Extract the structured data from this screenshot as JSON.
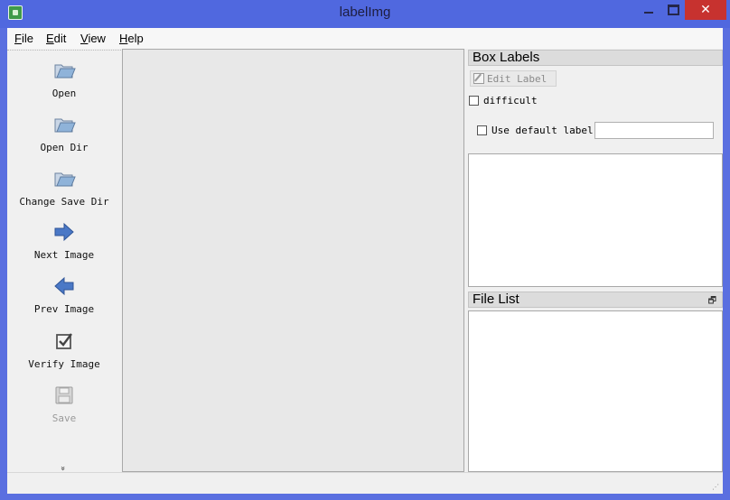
{
  "window": {
    "title": "labelImg",
    "close_glyph": "✕"
  },
  "menu": {
    "items": [
      {
        "label": "File",
        "accel": "F",
        "rest": "ile"
      },
      {
        "label": "Edit",
        "accel": "E",
        "rest": "dit"
      },
      {
        "label": "View",
        "accel": "V",
        "rest": "iew"
      },
      {
        "label": "Help",
        "accel": "H",
        "rest": "elp"
      }
    ]
  },
  "toolbar": {
    "items": [
      {
        "label": "Open",
        "icon": "folder-icon",
        "enabled": true
      },
      {
        "label": "Open Dir",
        "icon": "folder-icon",
        "enabled": true
      },
      {
        "label": "Change Save Dir",
        "icon": "folder-icon",
        "enabled": true
      },
      {
        "label": "Next Image",
        "icon": "arrow-right-icon",
        "enabled": true
      },
      {
        "label": "Prev Image",
        "icon": "arrow-left-icon",
        "enabled": true
      },
      {
        "label": "Verify Image",
        "icon": "checkbox-icon",
        "enabled": true
      },
      {
        "label": "Save",
        "icon": "save-icon",
        "enabled": false
      }
    ],
    "more_glyph": "»"
  },
  "box_labels": {
    "title": "Box Labels",
    "edit_label": "Edit Label",
    "difficult": "difficult",
    "use_default_label": "Use default label",
    "default_label_value": ""
  },
  "file_list": {
    "title": "File List",
    "float_glyph": "🗗"
  },
  "colors": {
    "titlebar": "#5068df",
    "close_button": "#c7322f",
    "arrow_blue": "#4a78c6",
    "folder_blue": "#8fb3d9"
  }
}
